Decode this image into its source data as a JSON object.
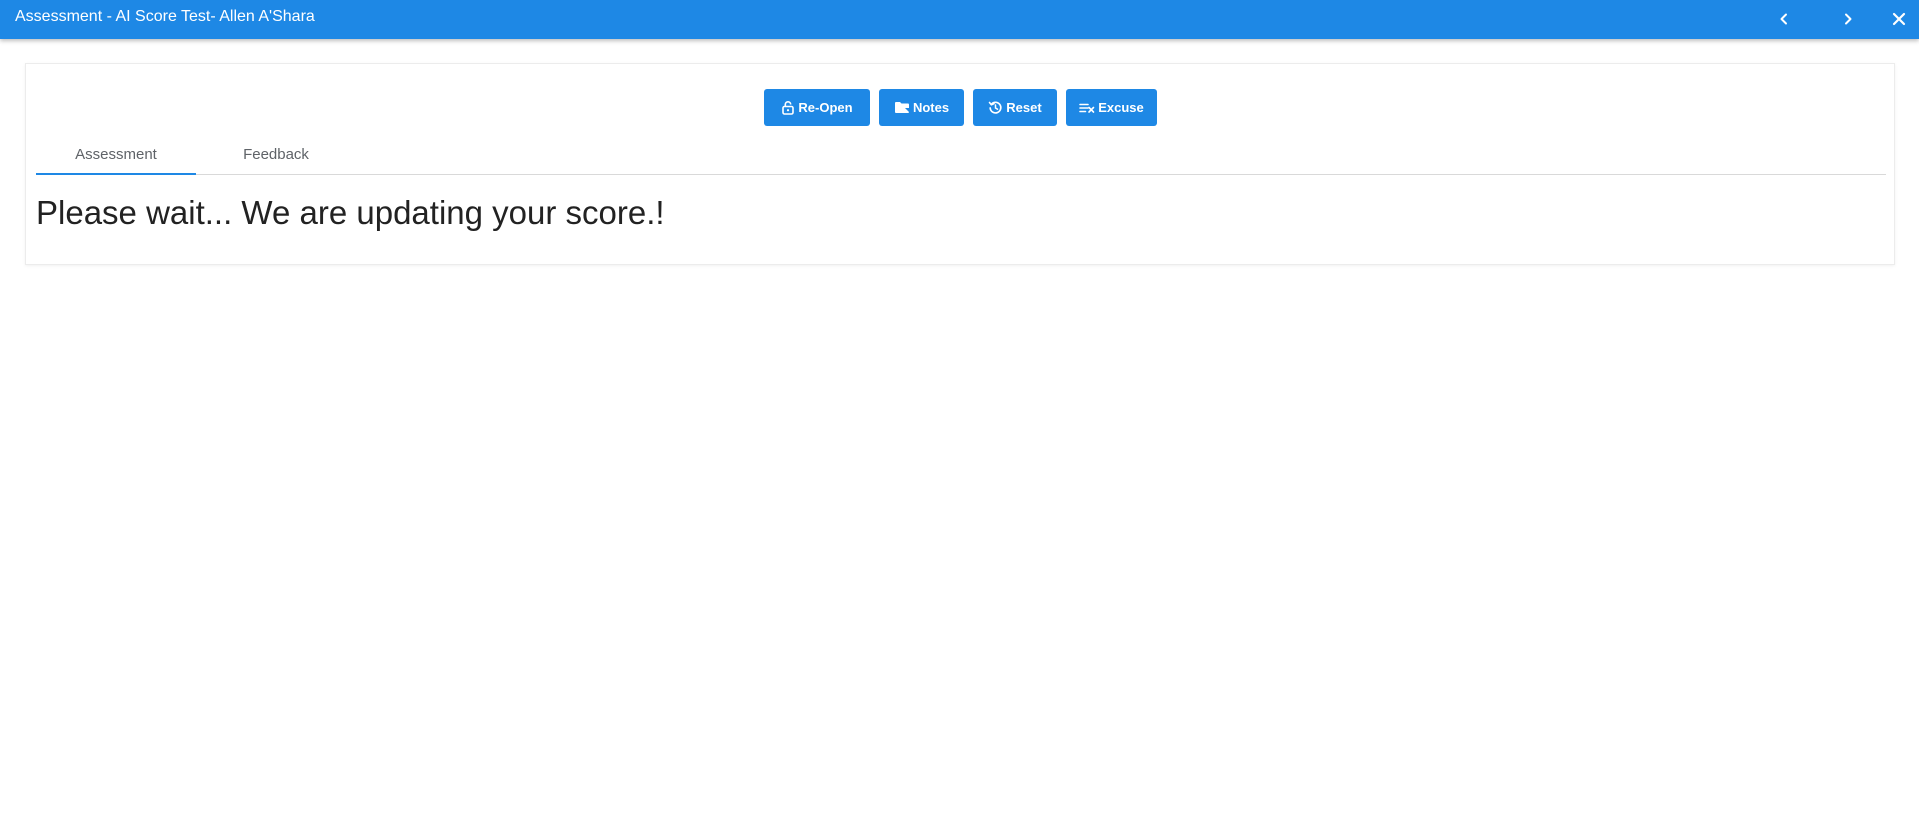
{
  "header": {
    "title": "Assessment - AI Score Test- Allen A'Shara",
    "icons": [
      "chevron-left-icon",
      "chevron-right-icon",
      "close-icon"
    ],
    "background_color": "#1e88e5"
  },
  "toolbar": {
    "reopen_label": "Re-Open",
    "notes_label": "Notes",
    "reset_label": "Reset",
    "excuse_label": "Excuse",
    "icons": [
      "lock-open-icon",
      "folder-icon",
      "restore-icon",
      "excuse-icon"
    ],
    "button_color": "#1e88e5"
  },
  "tabs": {
    "items": [
      {
        "label": "Assessment",
        "active": true
      },
      {
        "label": "Feedback",
        "active": false
      }
    ],
    "indicator_color": "#1e88e5"
  },
  "main": {
    "message": "Please wait... We are updating your score.!"
  }
}
